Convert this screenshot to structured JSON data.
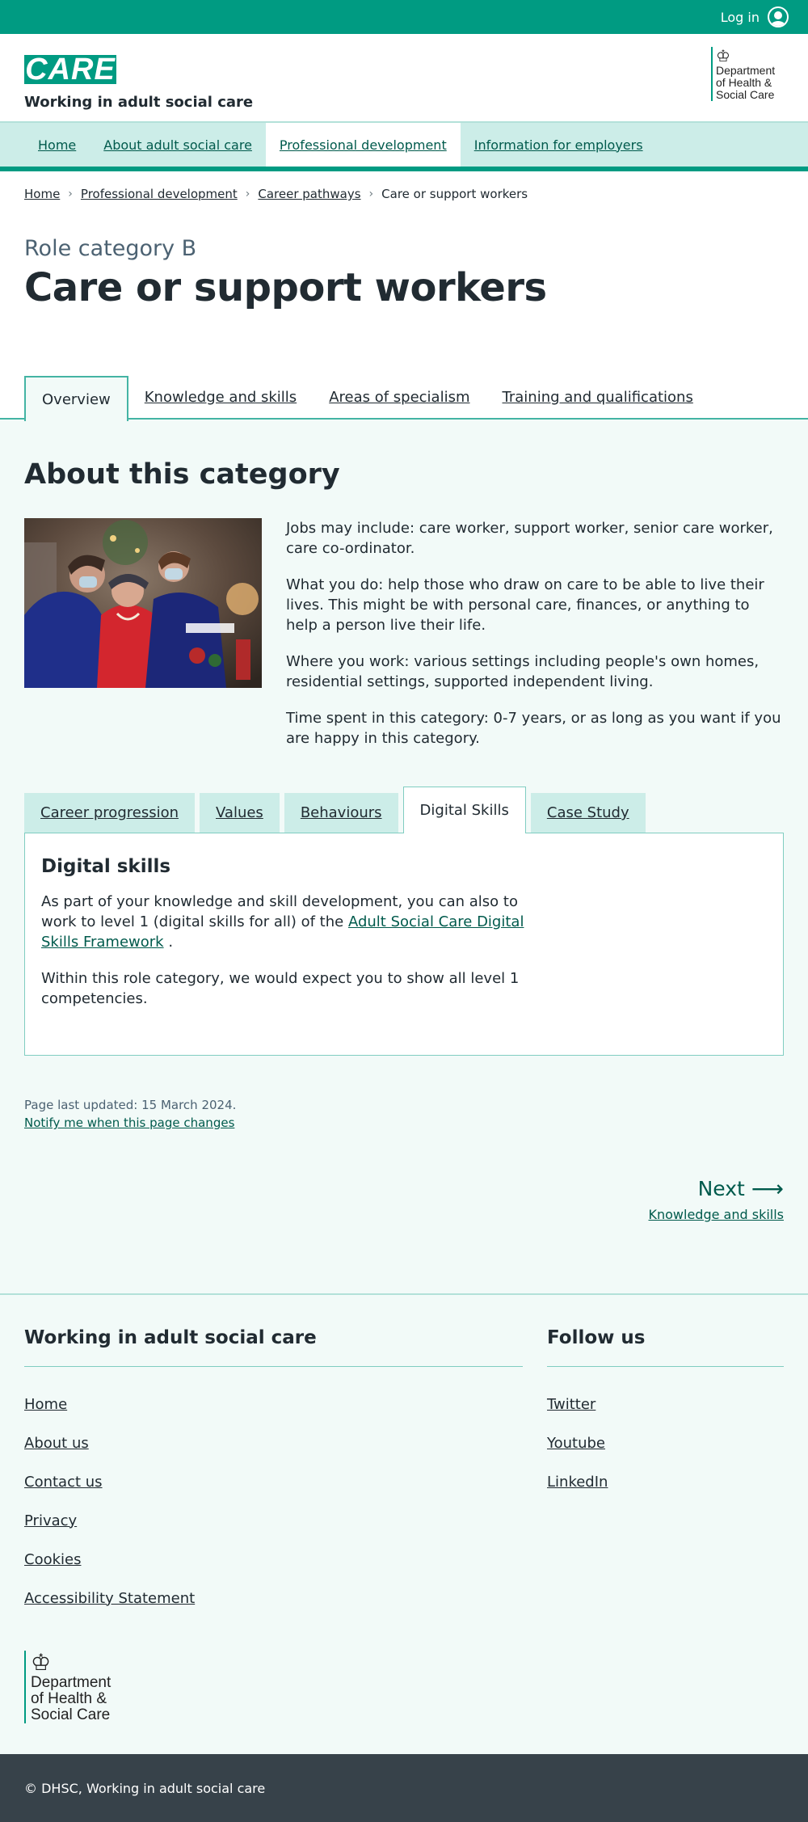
{
  "topbar": {
    "login_label": "Log in"
  },
  "header": {
    "logo_text": "CARE",
    "tagline": "Working in adult social care",
    "dhsc_lines": [
      "Department",
      "of Health &",
      "Social Care"
    ]
  },
  "nav": {
    "items": [
      {
        "label": "Home"
      },
      {
        "label": "About adult social care"
      },
      {
        "label": "Professional development",
        "active": true
      },
      {
        "label": "Information for employers"
      }
    ]
  },
  "breadcrumb": {
    "items": [
      "Home",
      "Professional development",
      "Career pathways"
    ],
    "current": "Care or support workers"
  },
  "title": {
    "role_category": "Role category B",
    "heading": "Care or support workers"
  },
  "main_tabs": [
    {
      "label": "Overview",
      "active": true
    },
    {
      "label": "Knowledge and skills"
    },
    {
      "label": "Areas of specialism"
    },
    {
      "label": "Training and qualifications"
    }
  ],
  "about": {
    "heading": "About this category",
    "paragraphs": [
      "Jobs may include: care worker, support worker, senior care worker, care co-ordinator.",
      "What you do: help those who draw on care to be able to live their lives. This might be with personal care, finances, or anything to help a person live their life.",
      "Where you work: various settings including people's own homes, residential settings, supported independent living.",
      "Time spent in this category: 0-7 years, or as long as you want if you are happy in this category."
    ]
  },
  "sub_tabs": [
    {
      "label": "Career progression"
    },
    {
      "label": "Values"
    },
    {
      "label": "Behaviours"
    },
    {
      "label": "Digital Skills",
      "active": true
    },
    {
      "label": "Case Study"
    }
  ],
  "panel": {
    "heading": "Digital skills",
    "p1_before": "As part of your knowledge and skill development, you can also to work to level 1 (digital skills for all) of the",
    "p1_link": "Adult Social Care Digital Skills Framework",
    "p1_after": " .",
    "p2": "Within this role category, we would expect you to show all level 1 competencies."
  },
  "meta": {
    "updated": "Page last updated: 15 March 2024.",
    "notify": "Notify me when this page changes"
  },
  "next": {
    "label": "Next",
    "sublabel": "Knowledge and skills"
  },
  "footer": {
    "left_heading": "Working in adult social care",
    "left_links": [
      "Home",
      "About us",
      "Contact us",
      "Privacy",
      "Cookies",
      "Accessibility Statement"
    ],
    "right_heading": "Follow us",
    "right_links": [
      "Twitter",
      "Youtube",
      "LinkedIn"
    ],
    "copyright": "© DHSC, Working in adult social care"
  },
  "icons": {
    "login": "user-circle-icon",
    "crumb_separator": "chevron-right-icon",
    "next": "arrow-right-icon",
    "crest": "royal-crest-icon"
  },
  "colors": {
    "brand_teal": "#009b82",
    "nav_bg": "#ccede8",
    "link_dark": "#005a4c",
    "content_bg": "#f2faf8",
    "footer_bar": "#37424a"
  }
}
